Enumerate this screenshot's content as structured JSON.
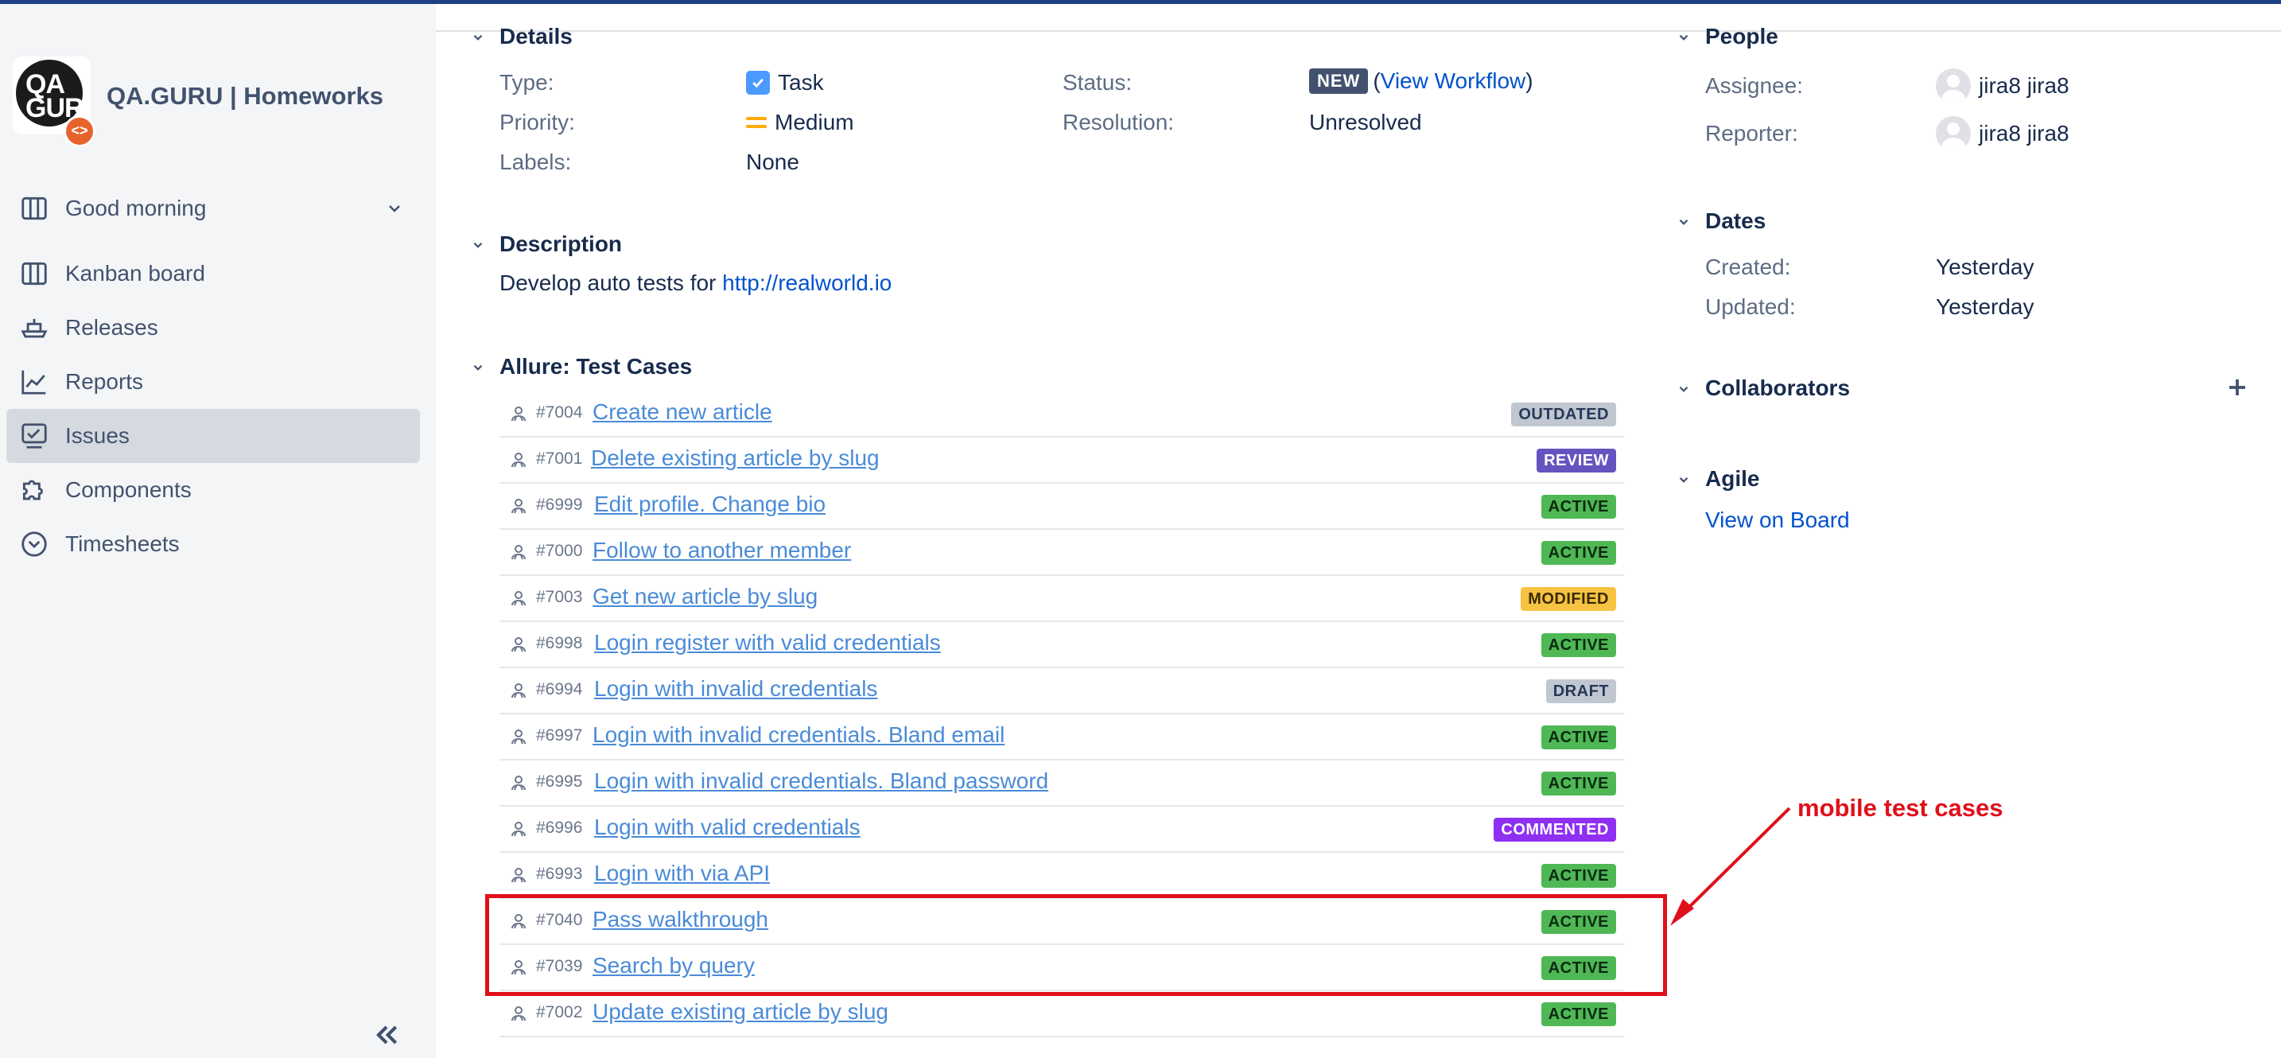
{
  "sidebar": {
    "logo_text": "QA GURU",
    "project_name": "QA.GURU | Homeworks",
    "items": [
      {
        "label": "Good morning",
        "icon": "board-icon"
      },
      {
        "label": "Kanban board",
        "icon": "kanban-icon"
      },
      {
        "label": "Releases",
        "icon": "ship-icon"
      },
      {
        "label": "Reports",
        "icon": "chart-line-icon"
      },
      {
        "label": "Issues",
        "icon": "issues-icon"
      },
      {
        "label": "Components",
        "icon": "puzzle-icon"
      },
      {
        "label": "Timesheets",
        "icon": "clock-icon"
      }
    ],
    "selected": "Issues"
  },
  "details": {
    "title": "Details",
    "type_label": "Type:",
    "type_value": "Task",
    "priority_label": "Priority:",
    "priority_value": "Medium",
    "labels_label": "Labels:",
    "labels_value": "None",
    "status_label": "Status:",
    "status_value": "NEW",
    "status_paren_open": "(",
    "status_link": "View Workflow",
    "status_paren_close": ")",
    "resolution_label": "Resolution:",
    "resolution_value": "Unresolved"
  },
  "description": {
    "title": "Description",
    "text": "Develop auto tests for",
    "link": "http://realworld.io"
  },
  "test_cases": {
    "title": "Allure: Test Cases",
    "rows": [
      {
        "id": "#7004",
        "name": "Create new article",
        "status": "OUTDATED"
      },
      {
        "id": "#7001",
        "name": "Delete existing article by slug",
        "status": "REVIEW"
      },
      {
        "id": "#6999",
        "name": "Edit profile. Change bio",
        "status": "ACTIVE"
      },
      {
        "id": "#7000",
        "name": "Follow to another member",
        "status": "ACTIVE"
      },
      {
        "id": "#7003",
        "name": "Get new article by slug",
        "status": "MODIFIED"
      },
      {
        "id": "#6998",
        "name": "Login register with valid credentials",
        "status": "ACTIVE"
      },
      {
        "id": "#6994",
        "name": "Login with invalid credentials",
        "status": "DRAFT"
      },
      {
        "id": "#6997",
        "name": "Login with invalid credentials. Bland email",
        "status": "ACTIVE"
      },
      {
        "id": "#6995",
        "name": "Login with invalid credentials. Bland password",
        "status": "ACTIVE"
      },
      {
        "id": "#6996",
        "name": "Login with valid credentials",
        "status": "COMMENTED"
      },
      {
        "id": "#6993",
        "name": "Login with via API",
        "status": "ACTIVE"
      },
      {
        "id": "#7040",
        "name": "Pass walkthrough",
        "status": "ACTIVE"
      },
      {
        "id": "#7039",
        "name": "Search by query",
        "status": "ACTIVE"
      },
      {
        "id": "#7002",
        "name": "Update existing article by slug",
        "status": "ACTIVE"
      }
    ]
  },
  "status_colors": {
    "OUTDATED": {
      "bg": "#c1c7d0",
      "fg": "#253858"
    },
    "REVIEW": {
      "bg": "#6554c0",
      "fg": "#ffffff"
    },
    "ACTIVE": {
      "bg": "#4fb855",
      "fg": "#0b2a10"
    },
    "MODIFIED": {
      "bg": "#f6c342",
      "fg": "#3a2a00"
    },
    "DRAFT": {
      "bg": "#c1c7d0",
      "fg": "#253858"
    },
    "COMMENTED": {
      "bg": "#8f2ff2",
      "fg": "#ffffff"
    }
  },
  "people": {
    "title": "People",
    "assignee_label": "Assignee:",
    "assignee_value": "jira8 jira8",
    "reporter_label": "Reporter:",
    "reporter_value": "jira8 jira8"
  },
  "dates": {
    "title": "Dates",
    "created_label": "Created:",
    "created_value": "Yesterday",
    "updated_label": "Updated:",
    "updated_value": "Yesterday"
  },
  "collaborators": {
    "title": "Collaborators"
  },
  "agile": {
    "title": "Agile",
    "link": "View on Board"
  },
  "annotation": {
    "text": "mobile test cases",
    "color": "#e0101a"
  }
}
